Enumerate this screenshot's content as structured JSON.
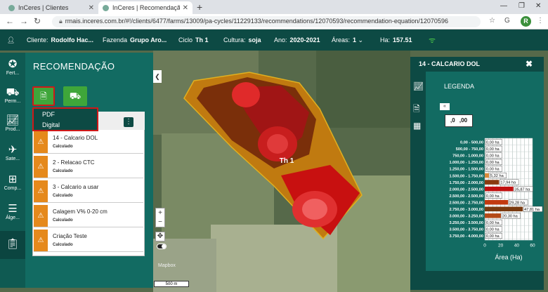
{
  "browser": {
    "tabs": [
      {
        "label": "InCeres | Clientes"
      },
      {
        "label": "InCeres | Recomendação"
      }
    ],
    "url": "rmais.inceres.com.br/#!/clients/6477/farms/13009/pa-cycles/11229133/recommendations/12070593/recommendation-equation/12070596",
    "profile_initial": "R"
  },
  "header": {
    "client_label": "Cliente:",
    "client_value": "Rodolfo Hac...",
    "farm_label": "Fazenda",
    "farm_value": "Grupo Aro...",
    "cycle_label": "Ciclo",
    "cycle_value": "Th 1",
    "crop_label": "Cultura:",
    "crop_value": "soja",
    "year_label": "Ano:",
    "year_value": "2020-2021",
    "areas_label": "Áreas:",
    "areas_value": "1",
    "ha_label": "Ha:",
    "ha_value": "157.51"
  },
  "rail": [
    {
      "label": "Fert...",
      "icon": "fertilizer-icon"
    },
    {
      "label": "Perm...",
      "icon": "permanent-icon"
    },
    {
      "label": "Prod...",
      "icon": "productivity-icon"
    },
    {
      "label": "Sate...",
      "icon": "satellite-icon"
    },
    {
      "label": "Comp...",
      "icon": "compare-icon"
    },
    {
      "label": "Álge...",
      "icon": "algebra-icon"
    },
    {
      "label": "",
      "icon": "recommendation-icon"
    }
  ],
  "panel": {
    "title": "RECOMENDAÇÃO",
    "dropdown": [
      "PDF",
      "Digital"
    ],
    "items": [
      {
        "name": "14 - Calcario DOL",
        "status": "Calculado"
      },
      {
        "name": "2 - Relacao CTC",
        "status": "Calculado"
      },
      {
        "name": "3 - Calcario a usar",
        "status": "Calculado"
      },
      {
        "name": "Calagem V% 0-20 cm",
        "status": "Calculado"
      },
      {
        "name": "Criação Teste",
        "status": "Calculado"
      }
    ]
  },
  "map": {
    "field_label": "Th 1",
    "logo": "Mapbox",
    "scale": "500 m",
    "zoom_in": "+",
    "zoom_out": "−"
  },
  "legend": {
    "header": "14 - CALCARIO DOL",
    "title": "LEGENDA",
    "decimals_minus": ",0",
    "decimals_plus": ",00"
  },
  "chart_data": {
    "type": "bar",
    "orientation": "horizontal",
    "xlabel": "Área (Ha)",
    "xlim": [
      0,
      60
    ],
    "xticks": [
      0,
      20,
      40,
      60
    ],
    "grid": true,
    "categories": [
      "0,00 - 500,00",
      "500,00 - 750,00",
      "750,00 - 1.000,00",
      "1.000,00 - 1.250,00",
      "1.250,00 - 1.500,00",
      "1.500,00 - 1.750,00",
      "1.750,00 - 2.000,00",
      "2.000,00 - 2.500,00",
      "2.500,00 - 2.500,00",
      "2.500,00 - 2.750,00",
      "2.750,00 - 3.000,00",
      "3.000,00 - 3.250,00",
      "3.250,00 - 3.500,00",
      "3.500,00 - 3.750,00",
      "3.750,00 - 4.000,00"
    ],
    "values": [
      0,
      0,
      0,
      0,
      0,
      5.32,
      17.94,
      35.87,
      0,
      29.28,
      47.81,
      20.3,
      0,
      0,
      0
    ],
    "value_labels": [
      "0,00 ha",
      "0,00 ha",
      "0,00 ha",
      "0,00 ha",
      "0,00 ha",
      "5,32 ha",
      "17,94 ha",
      "35,87 ha",
      "0,00 ha",
      "29,28 ha",
      "47,81 ha",
      "20,30 ha",
      "0,00 ha",
      "0,00 ha",
      "0,00 ha"
    ],
    "colors": [
      "#ffe9a8",
      "#ffe0a0",
      "#f7c878",
      "#f0b05a",
      "#e59a40",
      "#d98a3a",
      "#8a3a10",
      "#c01010",
      "#d02020",
      "#c23a10",
      "#7a3a10",
      "#b44a18",
      "#d06018",
      "#e07a20",
      "#f09a30"
    ]
  }
}
